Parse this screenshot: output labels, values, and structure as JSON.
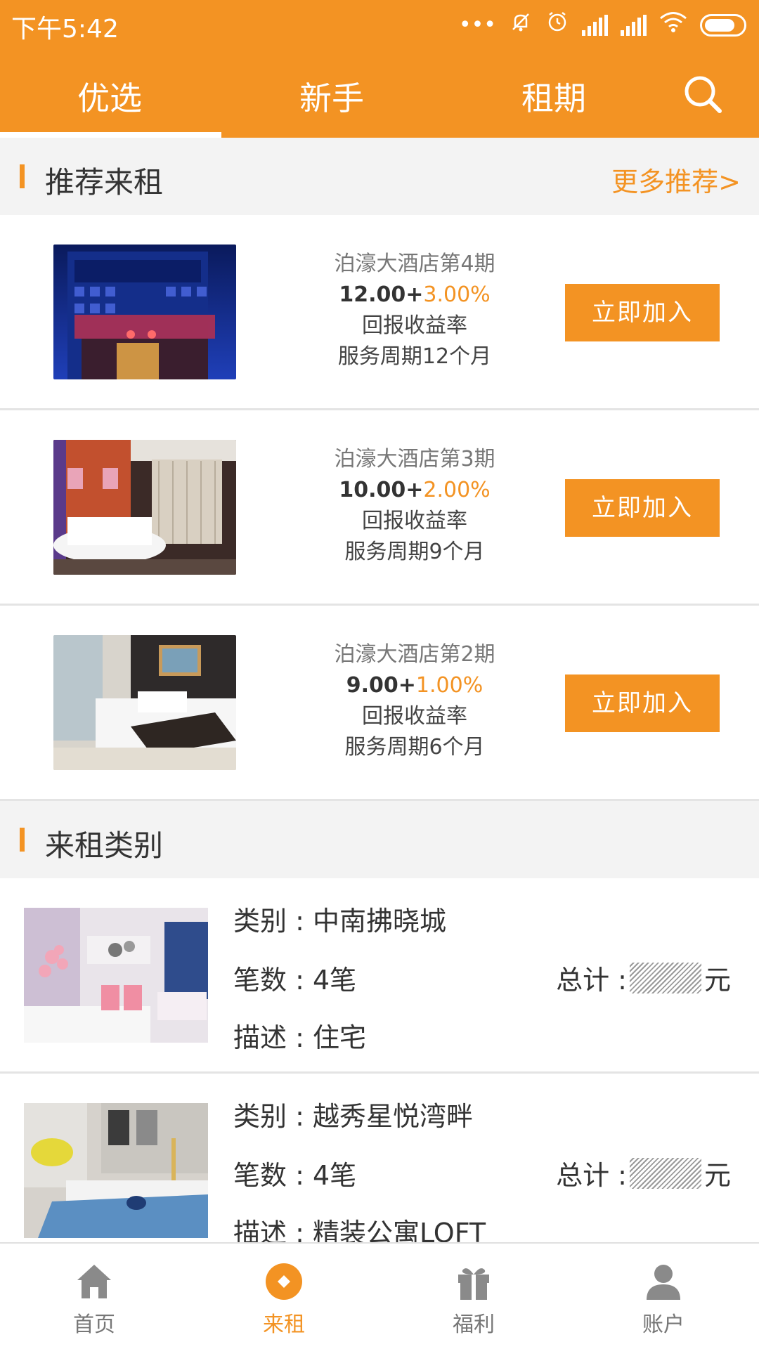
{
  "status_bar": {
    "time": "下午5:42"
  },
  "top_tabs": {
    "tabs": [
      {
        "label": "优选"
      },
      {
        "label": "新手"
      },
      {
        "label": "租期"
      }
    ],
    "active": "优选"
  },
  "recommend_section": {
    "title": "推荐来租",
    "more_label": "更多推荐>",
    "items": [
      {
        "name": "泊濠大酒店第4期",
        "base": "12.00+",
        "plus": "3.00%",
        "line1": "回报收益率",
        "line2": "服务周期12个月",
        "button": "立即加入"
      },
      {
        "name": "泊濠大酒店第3期",
        "base": "10.00+",
        "plus": "2.00%",
        "line1": "回报收益率",
        "line2": "服务周期9个月",
        "button": "立即加入"
      },
      {
        "name": "泊濠大酒店第2期",
        "base": "9.00+",
        "plus": "1.00%",
        "line1": "回报收益率",
        "line2": "服务周期6个月",
        "button": "立即加入"
      }
    ]
  },
  "category_section": {
    "title": "来租类别",
    "items": [
      {
        "category": "类别 : 中南拂晓城",
        "count": "笔数 : 4笔",
        "total_label": "总计 :",
        "total_unit": "元",
        "desc": "描述 : 住宅"
      },
      {
        "category": "类别 : 越秀星悦湾畔",
        "count": "笔数 : 4笔",
        "total_label": "总计 :",
        "total_unit": "元",
        "desc": "描述 : 精装公寓LOFT"
      }
    ]
  },
  "bottom_nav": {
    "items": [
      {
        "label": "首页"
      },
      {
        "label": "来租"
      },
      {
        "label": "福利"
      },
      {
        "label": "账户"
      }
    ],
    "active": "来租"
  },
  "colors": {
    "accent": "#f39323",
    "section_bg": "#f3f3f3",
    "divider": "#e4e4e4",
    "nav_inactive": "#777777"
  }
}
